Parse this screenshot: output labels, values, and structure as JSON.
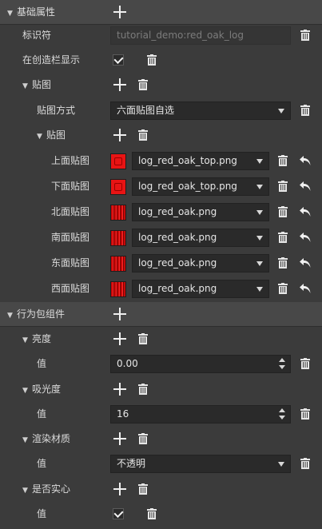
{
  "basic": {
    "title": "基础属性",
    "identifier_label": "标识符",
    "identifier_value": "tutorial_demo:red_oak_log",
    "creative_label": "在创造栏显示",
    "creative_checked": true,
    "texture": {
      "title": "贴图",
      "mode_label": "贴图方式",
      "mode_value": "六面贴图自选",
      "sub_title": "贴图",
      "faces": [
        {
          "label": "上面贴图",
          "file": "log_red_oak_top.png",
          "swatch": "top"
        },
        {
          "label": "下面贴图",
          "file": "log_red_oak_top.png",
          "swatch": "top"
        },
        {
          "label": "北面贴图",
          "file": "log_red_oak.png",
          "swatch": "bark"
        },
        {
          "label": "南面贴图",
          "file": "log_red_oak.png",
          "swatch": "bark"
        },
        {
          "label": "东面贴图",
          "file": "log_red_oak.png",
          "swatch": "bark"
        },
        {
          "label": "西面贴图",
          "file": "log_red_oak.png",
          "swatch": "bark"
        }
      ]
    }
  },
  "behavior": {
    "title": "行为包组件",
    "value_label": "值",
    "brightness": {
      "title": "亮度",
      "value": "0.00"
    },
    "absorption": {
      "title": "吸光度",
      "value": "16"
    },
    "material": {
      "title": "渲染材质",
      "value": "不透明"
    },
    "solid": {
      "title": "是否实心",
      "checked": true
    }
  },
  "colors": {
    "panel": "#3b3b3b",
    "section_header": "#484848",
    "field": "#2a2a2a",
    "texture_top": "#e81414",
    "texture_bark": "#c50808"
  },
  "icons": [
    "collapse-arrow-icon",
    "plus-icon",
    "trash-icon",
    "undo-icon",
    "dropdown-caret-icon",
    "spinner-icon",
    "checkbox-icon"
  ]
}
